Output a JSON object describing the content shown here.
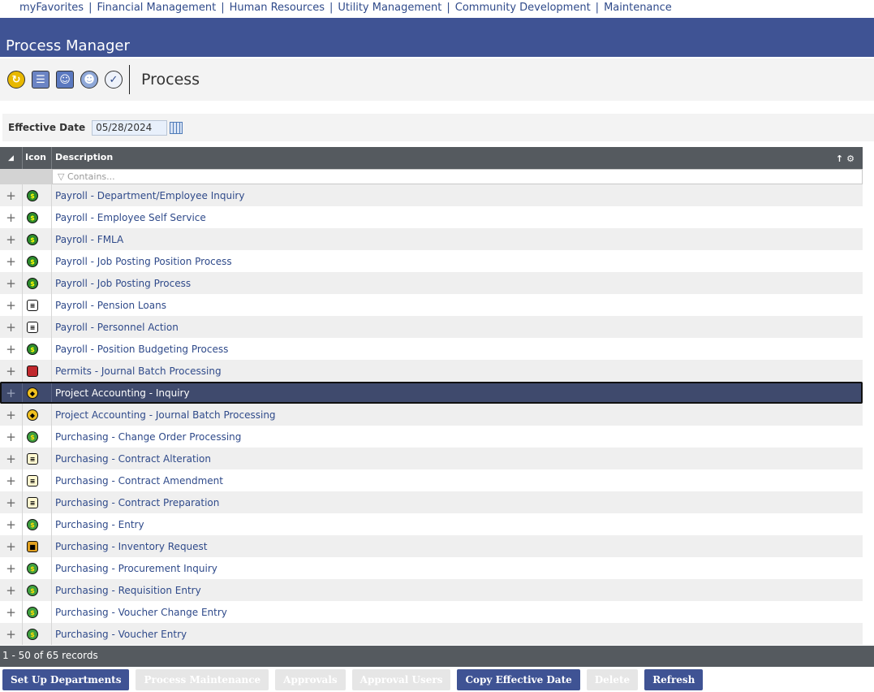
{
  "nav": [
    "myFavorites",
    "Financial Management",
    "Human Resources",
    "Utility Management",
    "Community Development",
    "Maintenance"
  ],
  "title": "Process Manager",
  "toolbar": {
    "title": "Process",
    "icons": [
      "refresh-icon",
      "calendar-list-icon",
      "people-icon",
      "user-search-icon",
      "approve-icon"
    ]
  },
  "effective_date": {
    "label": "Effective Date",
    "value": "05/28/2024"
  },
  "grid": {
    "columns": {
      "icon": "Icon",
      "description": "Description"
    },
    "filter_placeholder": "Contains...",
    "rows": [
      {
        "description": "Payroll - Department/Employee Inquiry",
        "icon": "payroll-icon"
      },
      {
        "description": "Payroll - Employee Self Service",
        "icon": "payroll-icon"
      },
      {
        "description": "Payroll - FMLA",
        "icon": "payroll-icon"
      },
      {
        "description": "Payroll - Job Posting Position Process",
        "icon": "payroll-icon"
      },
      {
        "description": "Payroll - Job Posting Process",
        "icon": "payroll-icon"
      },
      {
        "description": "Payroll - Pension Loans",
        "icon": "book-icon"
      },
      {
        "description": "Payroll - Personnel Action",
        "icon": "book-icon"
      },
      {
        "description": "Payroll - Position Budgeting Process",
        "icon": "payroll-icon"
      },
      {
        "description": "Permits - Journal Batch Processing",
        "icon": "permit-icon"
      },
      {
        "description": "Project Accounting - Inquiry",
        "icon": "project-icon",
        "selected": true
      },
      {
        "description": "Project Accounting - Journal Batch Processing",
        "icon": "project-icon"
      },
      {
        "description": "Purchasing - Change Order Processing",
        "icon": "purchasing-icon"
      },
      {
        "description": "Purchasing - Contract Alteration",
        "icon": "contract-icon"
      },
      {
        "description": "Purchasing - Contract Amendment",
        "icon": "contract-icon"
      },
      {
        "description": "Purchasing - Contract Preparation",
        "icon": "contract-icon"
      },
      {
        "description": "Purchasing - Entry",
        "icon": "purchasing-icon"
      },
      {
        "description": "Purchasing - Inventory Request",
        "icon": "inventory-icon"
      },
      {
        "description": "Purchasing - Procurement Inquiry",
        "icon": "purchasing-icon"
      },
      {
        "description": "Purchasing - Requisition Entry",
        "icon": "purchasing-icon"
      },
      {
        "description": "Purchasing - Voucher Change Entry",
        "icon": "purchasing-icon"
      },
      {
        "description": "Purchasing - Voucher Entry",
        "icon": "purchasing-icon"
      }
    ]
  },
  "pager": "1 - 50 of 65 records",
  "buttons": [
    {
      "label": "Set Up Departments",
      "enabled": true
    },
    {
      "label": "Process Maintenance",
      "enabled": false
    },
    {
      "label": "Approvals",
      "enabled": false
    },
    {
      "label": "Approval Users",
      "enabled": false
    },
    {
      "label": "Copy Effective Date",
      "enabled": true
    },
    {
      "label": "Delete",
      "enabled": false
    },
    {
      "label": "Refresh",
      "enabled": true
    }
  ],
  "colors": {
    "accent": "#3f5394",
    "grid_header": "#555a5f",
    "link": "#2f4a8a"
  }
}
